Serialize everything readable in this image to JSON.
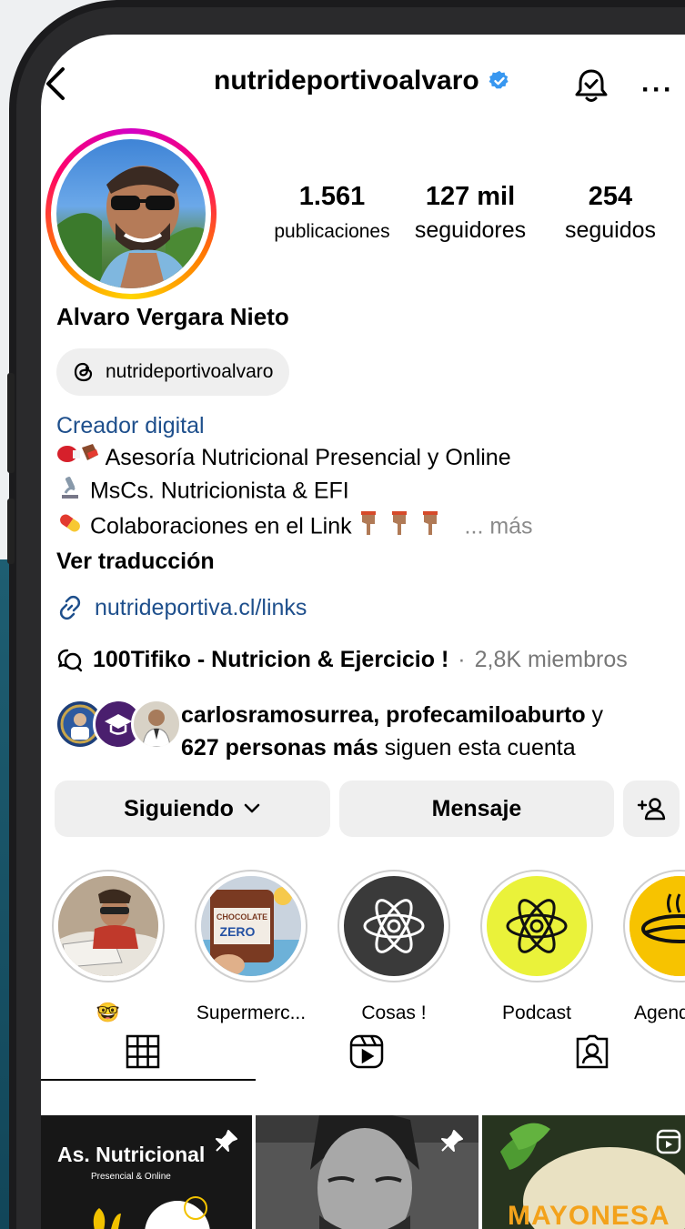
{
  "header": {
    "username": "nutrideportivoalvaro"
  },
  "profile": {
    "posts_count": "1.561",
    "posts_label": "publicaciones",
    "followers_count": "127 mil",
    "followers_label": "seguidores",
    "following_count": "254",
    "following_label": "seguidos",
    "name": "Alvaro Vergara Nieto",
    "threads_handle": "nutrideportivoalvaro",
    "category": "Creador digital",
    "bio_line1": "Asesoría Nutricional Presencial y Online",
    "bio_line2": "MsCs. Nutricionista & EFI",
    "bio_line3": "Colaboraciones en el Link",
    "more_label": "... más",
    "translate_label": "Ver traducción",
    "link": "nutrideportiva.cl/links",
    "community_name": "100Tifiko - Nutricion & Ejercicio !",
    "community_sep": "·",
    "community_members": "2,8K miembros",
    "followed_by_names": "carlosramosurrea, profecamiloaburto",
    "followed_by_and": " y",
    "followed_by_count": "627 personas más",
    "followed_by_suffix": " siguen esta cuenta"
  },
  "buttons": {
    "following": "Siguiendo",
    "message": "Mensaje"
  },
  "highlights": [
    {
      "label": "🤓"
    },
    {
      "label": "Supermerc..."
    },
    {
      "label": "Cosas !"
    },
    {
      "label": "Podcast"
    },
    {
      "label": "Agend"
    }
  ],
  "grid": {
    "tile1_title": "As. Nutricional",
    "tile1_sub": "Presencial & Online",
    "tile3_title": "MAYONESA",
    "highlight2_text1": "CHOCOLATE",
    "highlight2_text2": "ZERO"
  },
  "colors": {
    "link_blue": "#1e4f8c",
    "verified_blue": "#3897f0",
    "button_bg": "#efefef"
  }
}
